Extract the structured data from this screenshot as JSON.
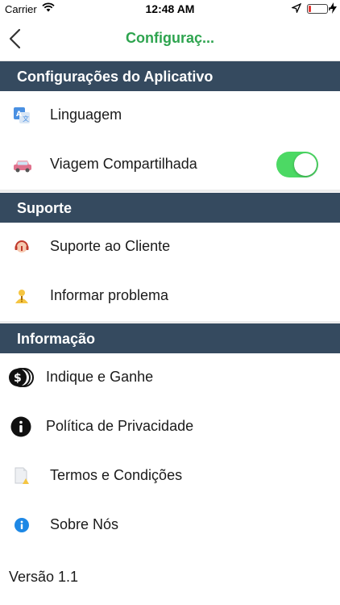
{
  "status_bar": {
    "carrier": "Carrier",
    "time": "12:48 AM",
    "battery_level": 0.15
  },
  "nav": {
    "title": "Configuraç..."
  },
  "sections": [
    {
      "title": "Configurações do Aplicativo",
      "items": [
        {
          "label": "Linguagem",
          "icon": "translate-icon"
        },
        {
          "label": "Viagem Compartilhada",
          "icon": "car-icon",
          "toggle": true
        }
      ]
    },
    {
      "title": "Suporte",
      "items": [
        {
          "label": "Suporte ao Cliente",
          "icon": "headset-icon"
        },
        {
          "label": "Informar problema",
          "icon": "report-icon"
        }
      ]
    },
    {
      "title": "Informação",
      "items": [
        {
          "label": "Indique e Ganhe",
          "icon": "coins-icon"
        },
        {
          "label": "Política de Privacidade",
          "icon": "info-black-icon"
        },
        {
          "label": "Termos e Condições",
          "icon": "document-icon"
        },
        {
          "label": "Sobre Nós",
          "icon": "info-blue-icon"
        }
      ]
    }
  ],
  "version": "Versão 1.1",
  "colors": {
    "accent": "#2ea44f",
    "header_bg": "#354a5f",
    "toggle_on": "#4cd964"
  }
}
